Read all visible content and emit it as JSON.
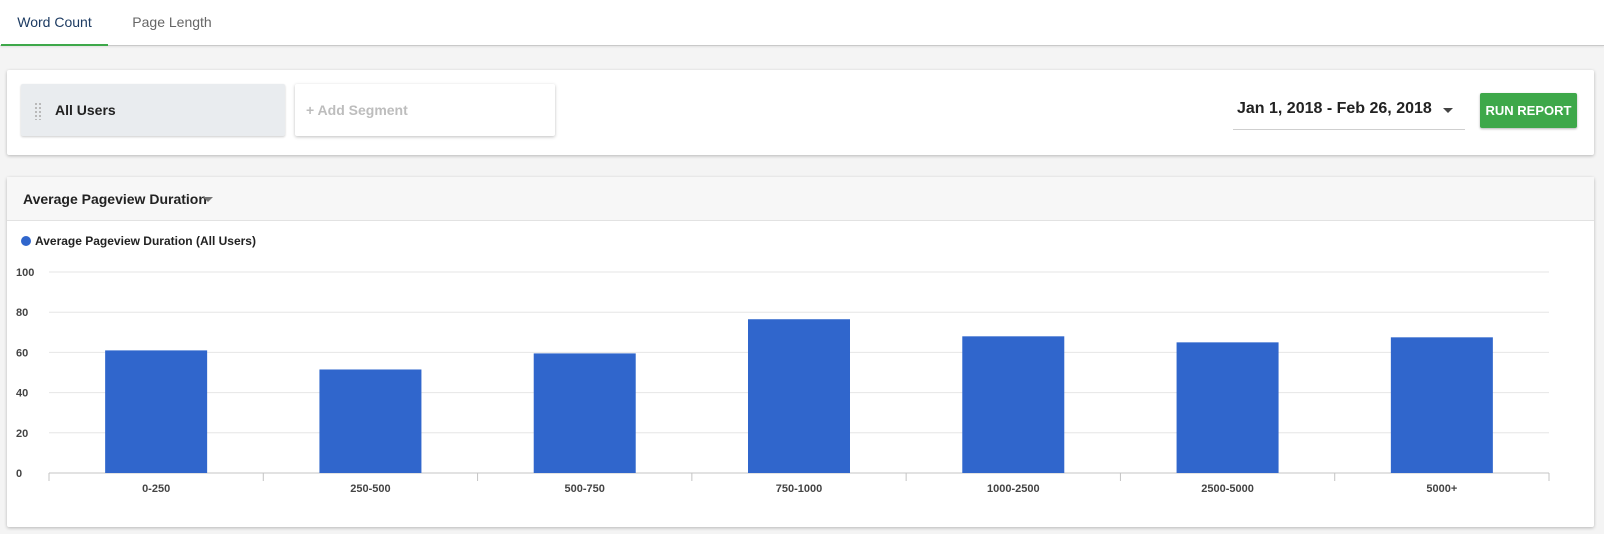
{
  "tabs": [
    {
      "label": "Word Count",
      "active": true
    },
    {
      "label": "Page Length",
      "active": false
    }
  ],
  "segments": {
    "selected": "All Users",
    "add_label": "+ Add Segment"
  },
  "date_range": "Jan 1, 2018 - Feb 26, 2018",
  "run_button": "RUN REPORT",
  "metric_selector": "Average Pageview Duration",
  "colors": {
    "accent_green": "#3ea84a",
    "bar_blue": "#3066cc",
    "active_tab_text": "#1d3b62"
  },
  "chart_data": {
    "type": "bar",
    "categories": [
      "0-250",
      "250-500",
      "500-750",
      "750-1000",
      "1000-2500",
      "2500-5000",
      "5000+"
    ],
    "series": [
      {
        "name": "Average Pageview Duration (All Users)",
        "values": [
          61,
          51.5,
          59.5,
          76.5,
          68,
          65,
          67.5
        ]
      }
    ],
    "ylim": [
      0,
      100
    ],
    "yticks": [
      0,
      20,
      40,
      60,
      80,
      100
    ],
    "grid": true,
    "legend_position": "top-left"
  }
}
